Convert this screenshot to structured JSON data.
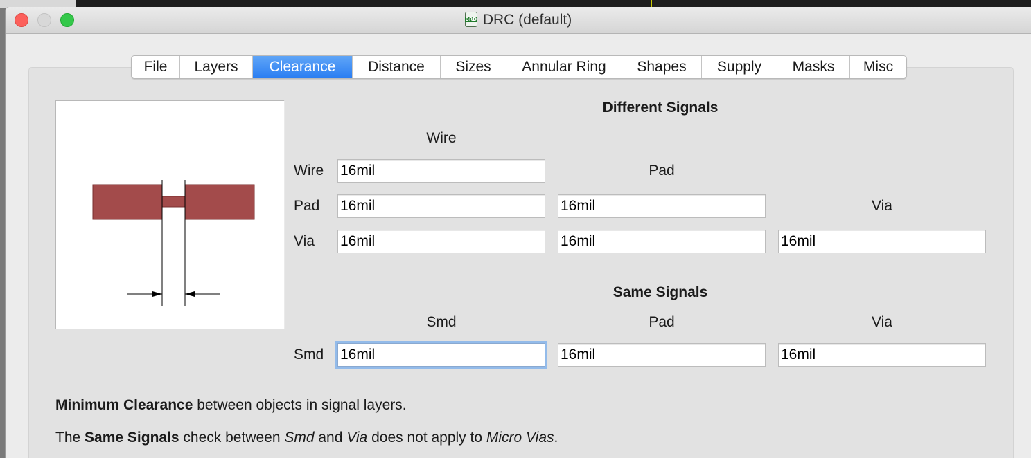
{
  "window": {
    "title": "DRC (default)",
    "title_icon_text": "BRD"
  },
  "tabs": [
    {
      "label": "File",
      "active": false
    },
    {
      "label": "Layers",
      "active": false
    },
    {
      "label": "Clearance",
      "active": true
    },
    {
      "label": "Distance",
      "active": false
    },
    {
      "label": "Sizes",
      "active": false
    },
    {
      "label": "Annular Ring",
      "active": false
    },
    {
      "label": "Shapes",
      "active": false
    },
    {
      "label": "Supply",
      "active": false
    },
    {
      "label": "Masks",
      "active": false
    },
    {
      "label": "Misc",
      "active": false
    }
  ],
  "different_signals": {
    "heading": "Different Signals",
    "col_wire": "Wire",
    "col_pad": "Pad",
    "col_via": "Via",
    "row_wire": "Wire",
    "row_pad": "Pad",
    "row_via": "Via",
    "wire_wire": "16mil",
    "pad_wire": "16mil",
    "pad_pad": "16mil",
    "via_wire": "16mil",
    "via_pad": "16mil",
    "via_via": "16mil"
  },
  "same_signals": {
    "heading": "Same Signals",
    "col_smd": "Smd",
    "col_pad": "Pad",
    "col_via": "Via",
    "row_smd": "Smd",
    "smd_smd": "16mil",
    "smd_pad": "16mil",
    "smd_via": "16mil"
  },
  "help": {
    "line1_bold": "Minimum Clearance",
    "line1_rest": " between objects in signal layers.",
    "line2_prefix": "The ",
    "line2_bold": "Same Signals",
    "line2_mid1": " check between ",
    "line2_em1": "Smd",
    "line2_mid2": " and ",
    "line2_em2": "Via",
    "line2_mid3": " does not apply to ",
    "line2_em3": "Micro Vias",
    "line2_end": "."
  },
  "colors": {
    "trace": "#a34b4b",
    "tab_active": "#2b7ef2",
    "focus_ring": "#93bbea"
  }
}
